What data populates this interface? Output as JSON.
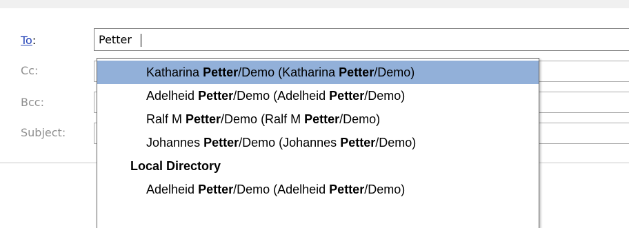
{
  "compose": {
    "to_label": "To",
    "to_colon": ":",
    "cc_label": "Cc:",
    "bcc_label": "Bcc:",
    "subject_label": "Subject:",
    "to_value": "Petter"
  },
  "autocomplete": {
    "items": [
      {
        "first": "Katharina ",
        "match": "Petter",
        "rest": "/Demo  (Katharina ",
        "match2": "Petter",
        "rest2": "/Demo)",
        "selected": true
      },
      {
        "first": "Adelheid ",
        "match": "Petter",
        "rest": "/Demo  (Adelheid ",
        "match2": "Petter",
        "rest2": "/Demo)",
        "selected": false
      },
      {
        "first": "Ralf M ",
        "match": "Petter",
        "rest": "/Demo  (Ralf M ",
        "match2": "Petter",
        "rest2": "/Demo)",
        "selected": false
      },
      {
        "first": "Johannes ",
        "match": "Petter",
        "rest": "/Demo  (Johannes ",
        "match2": "Petter",
        "rest2": "/Demo)",
        "selected": false
      }
    ],
    "section_heading": "Local Directory",
    "local_items": [
      {
        "first": "Adelheid ",
        "match": "Petter",
        "rest": "/Demo  (Adelheid ",
        "match2": "Petter",
        "rest2": "/Demo)"
      }
    ]
  },
  "colors": {
    "selection": "#92b0d9",
    "link": "#1f3fb6",
    "label_gray": "#8f8f8f"
  }
}
